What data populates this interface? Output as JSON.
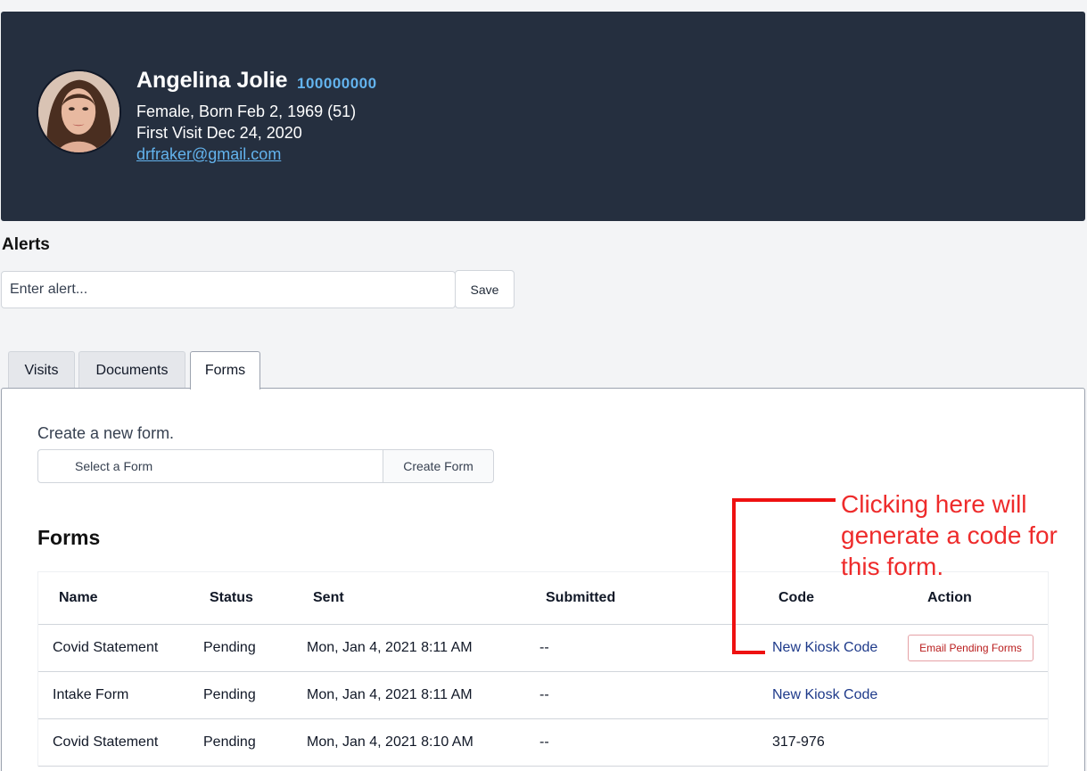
{
  "patient": {
    "name": "Angelina Jolie",
    "id": "100000000",
    "demographics": "Female, Born Feb 2, 1969 (51)",
    "first_visit": "First Visit Dec 24, 2020",
    "email": "drfraker@gmail.com"
  },
  "alerts": {
    "title": "Alerts",
    "placeholder": "Enter alert...",
    "save_label": "Save"
  },
  "tabs": [
    {
      "label": "Visits"
    },
    {
      "label": "Documents"
    },
    {
      "label": "Forms"
    }
  ],
  "forms_tab": {
    "create_label": "Create a new form.",
    "select_value": "Select a Form",
    "create_button": "Create Form",
    "section_title": "Forms",
    "columns": [
      "Name",
      "Status",
      "Sent",
      "Submitted",
      "Code",
      "Action"
    ],
    "rows": [
      {
        "name": "Covid Statement",
        "status": "Pending",
        "sent": "Mon, Jan 4, 2021 8:11 AM",
        "submitted": "--",
        "code": "New Kiosk Code",
        "action": "Email Pending Forms"
      },
      {
        "name": "Intake Form",
        "status": "Pending",
        "sent": "Mon, Jan 4, 2021 8:11 AM",
        "submitted": "--",
        "code": "New Kiosk Code",
        "action": ""
      },
      {
        "name": "Covid Statement",
        "status": "Pending",
        "sent": "Mon, Jan 4, 2021 8:10 AM",
        "submitted": "--",
        "code": "317-976",
        "action": ""
      }
    ]
  },
  "annotation": {
    "text": "Clicking here will generate a code for this form.",
    "color": "#ee1111"
  }
}
